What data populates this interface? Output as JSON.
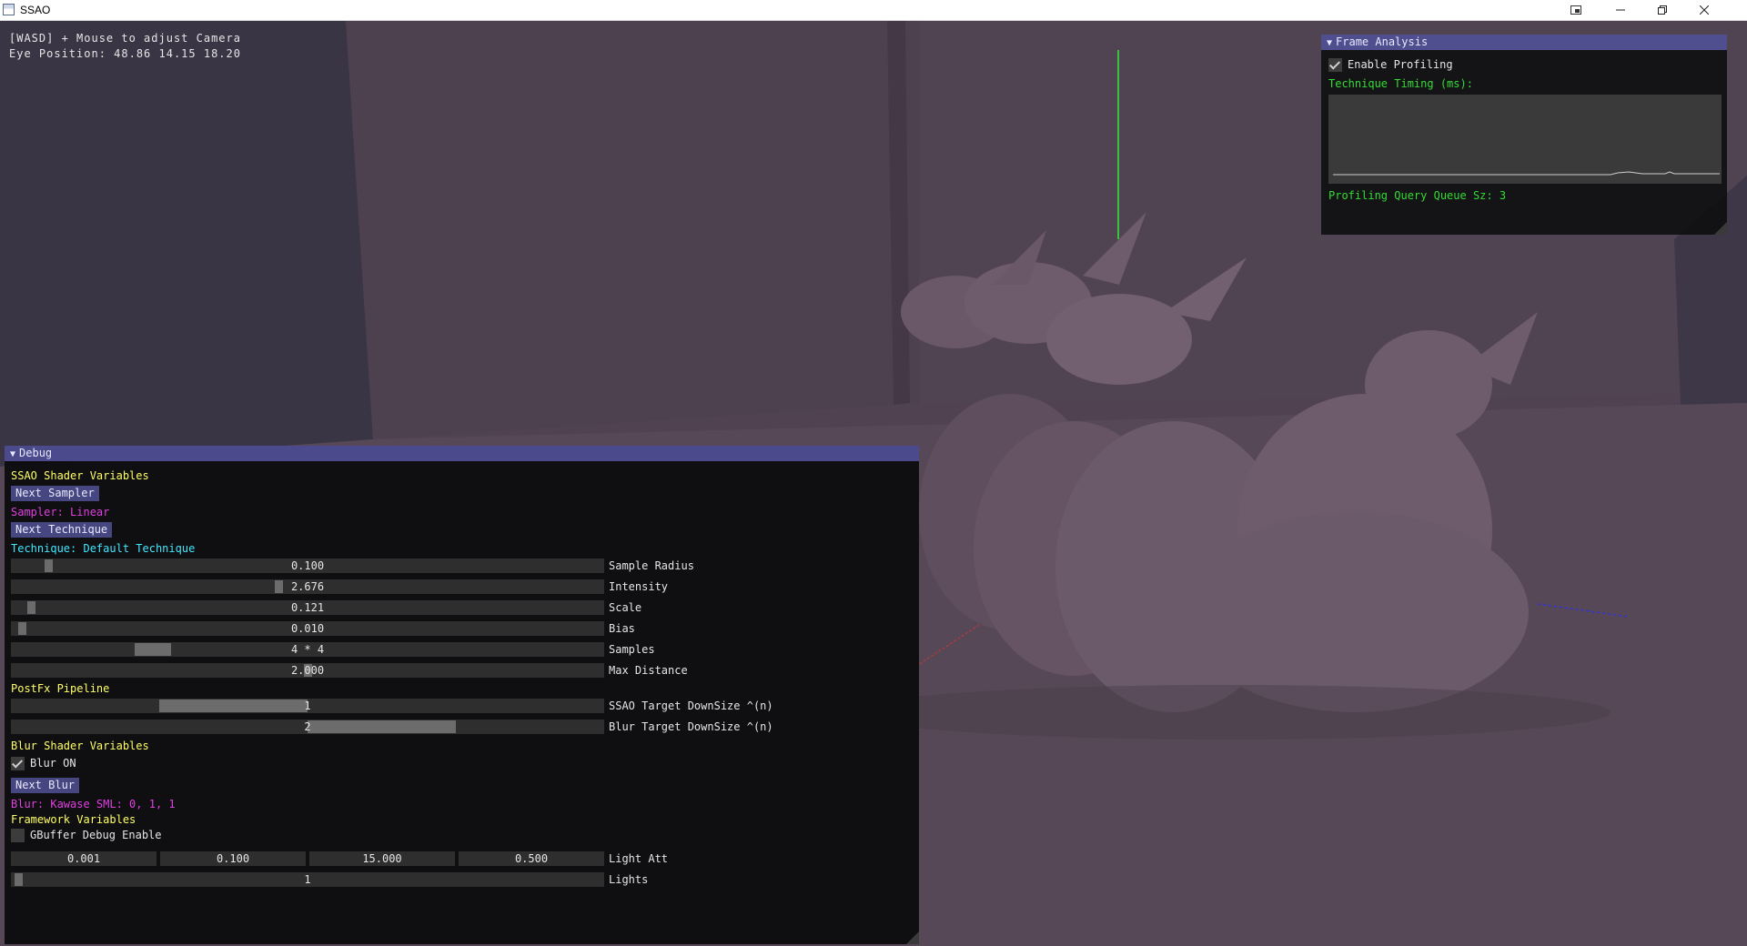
{
  "window": {
    "title": "SSAO",
    "controls": [
      "snap-icon",
      "minimize-icon",
      "restore-icon",
      "close-icon"
    ]
  },
  "overlay": {
    "line1": "[WASD] + Mouse to adjust Camera",
    "line2": "Eye Position: 48.86 14.15 18.20"
  },
  "frame_analysis": {
    "title": "Frame Analysis",
    "enable_profiling": {
      "label": "Enable Profiling",
      "checked": true
    },
    "timing_label": "Technique Timing (ms):",
    "queue_label": "Profiling Query Queue Sz: 3"
  },
  "debug": {
    "title": "Debug",
    "ssao_header": "SSAO Shader Variables",
    "next_sampler": "Next Sampler",
    "sampler_text": "Sampler: Linear",
    "next_technique": "Next Technique",
    "technique_text": "Technique: Default Technique",
    "sliders": [
      {
        "value": "0.100",
        "label": "Sample Radius",
        "fraction": 0.055
      },
      {
        "value": "2.676",
        "label": "Intensity",
        "fraction": 0.45
      },
      {
        "value": "0.121",
        "label": "Scale",
        "fraction": 0.025
      },
      {
        "value": "0.010",
        "label": "Bias",
        "fraction": 0.01
      },
      {
        "value": "4 * 4",
        "label": "Samples",
        "fraction": 0.22
      },
      {
        "value": "2.000",
        "label": "Max Distance",
        "fraction": 0.5
      }
    ],
    "postfx_header": "PostFx Pipeline",
    "postfx_sliders": [
      {
        "value": "1",
        "label": "SSAO Target DownSize ^(n)",
        "fraction": 0.5
      },
      {
        "value": "2",
        "label": "Blur Target DownSize ^(n)",
        "fraction": 0.75
      }
    ],
    "blur_header": "Blur Shader Variables",
    "blur_on": {
      "label": "Blur ON",
      "checked": true
    },
    "next_blur": "Next Blur",
    "blur_text": "Blur: Kawase SML: 0, 1, 1",
    "framework_header": "Framework Variables",
    "gbuffer_debug": {
      "label": "GBuffer Debug Enable",
      "checked": false
    },
    "light_att": {
      "values": [
        "0.001",
        "0.100",
        "15.000",
        "0.500"
      ],
      "label": "Light Att"
    },
    "lights": {
      "value": "1",
      "label": "Lights",
      "fraction": 0.01
    }
  },
  "colors": {
    "header_bar": "#4a4a8c",
    "button": "#464680",
    "text_yellow": "#ffff66",
    "text_magenta": "#e040e0",
    "text_cyan": "#40e8ff",
    "text_green": "#33dd33"
  }
}
